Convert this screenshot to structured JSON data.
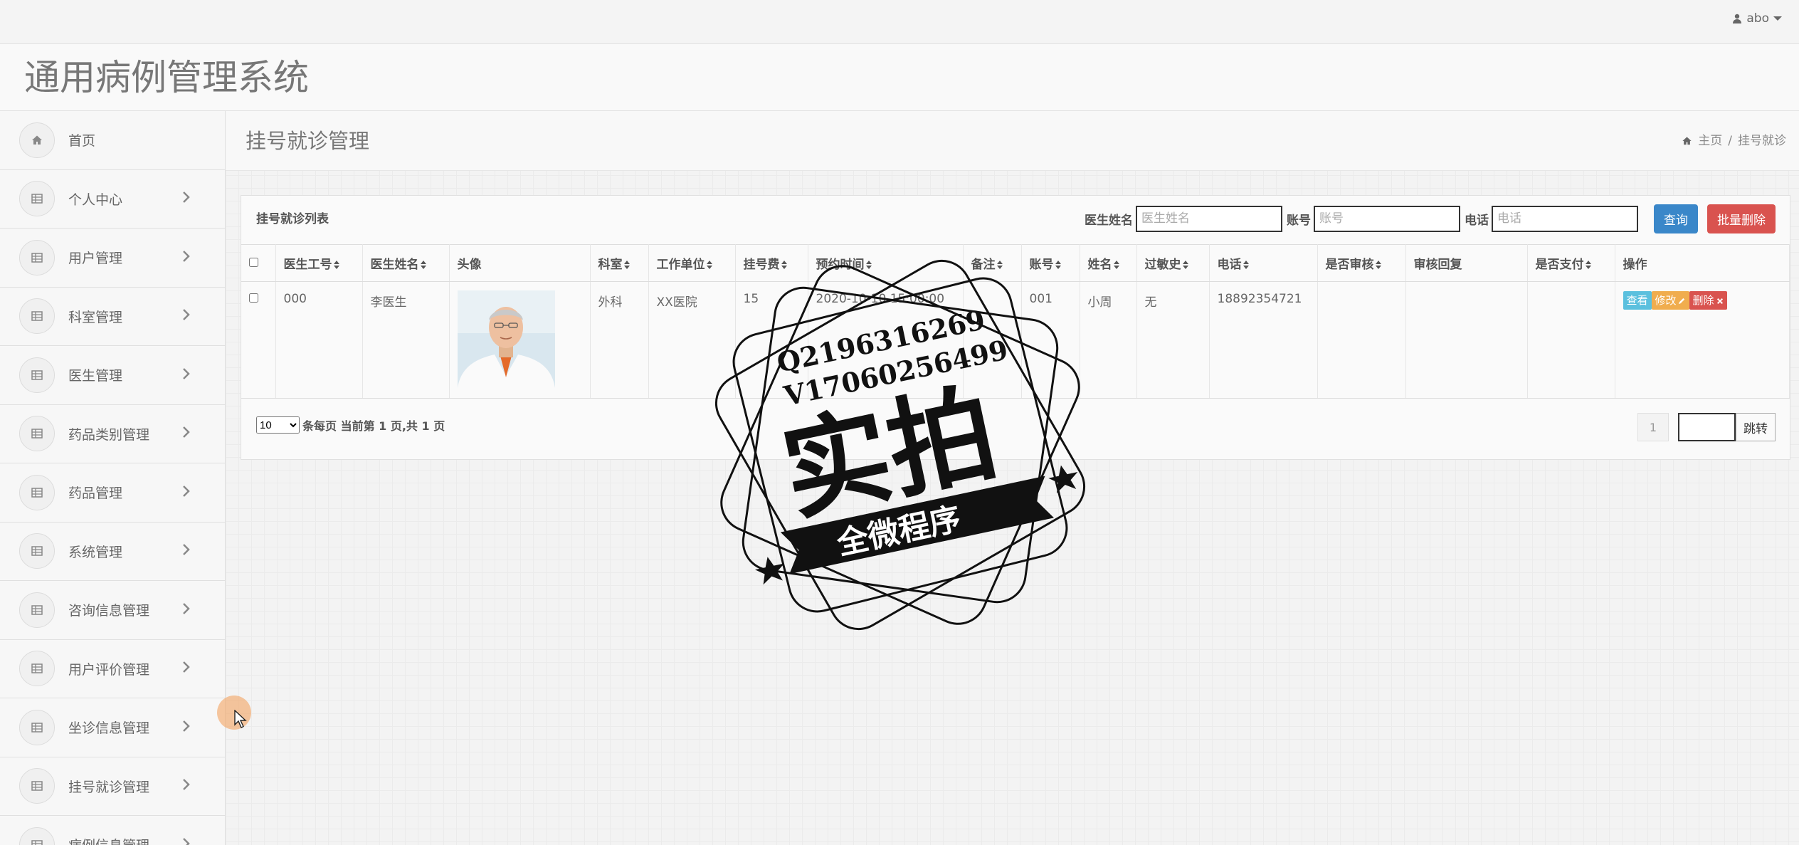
{
  "app": {
    "title": "通用病例管理系统",
    "user": "abo"
  },
  "sidebar": {
    "items": [
      {
        "label": "首页",
        "icon": "home-icon",
        "chevron": false
      },
      {
        "label": "个人中心",
        "icon": "grid-icon",
        "chevron": true
      },
      {
        "label": "用户管理",
        "icon": "grid-icon",
        "chevron": true
      },
      {
        "label": "科室管理",
        "icon": "grid-icon",
        "chevron": true
      },
      {
        "label": "医生管理",
        "icon": "grid-icon",
        "chevron": true
      },
      {
        "label": "药品类别管理",
        "icon": "grid-icon",
        "chevron": true
      },
      {
        "label": "药品管理",
        "icon": "grid-icon",
        "chevron": true
      },
      {
        "label": "系统管理",
        "icon": "grid-icon",
        "chevron": true
      },
      {
        "label": "咨询信息管理",
        "icon": "grid-icon",
        "chevron": true
      },
      {
        "label": "用户评价管理",
        "icon": "grid-icon",
        "chevron": true
      },
      {
        "label": "坐诊信息管理",
        "icon": "grid-icon",
        "chevron": true
      },
      {
        "label": "挂号就诊管理",
        "icon": "grid-icon",
        "chevron": true
      },
      {
        "label": "病例信息管理",
        "icon": "grid-icon",
        "chevron": true
      }
    ]
  },
  "page": {
    "title": "挂号就诊管理",
    "breadcrumb": {
      "home": "主页",
      "separator": "/",
      "current": "挂号就诊"
    }
  },
  "panel": {
    "title": "挂号就诊列表",
    "search": {
      "doctor_name_label": "医生姓名",
      "doctor_name_placeholder": "医生姓名",
      "account_label": "账号",
      "account_placeholder": "账号",
      "phone_label": "电话",
      "phone_placeholder": "电话",
      "query_button": "查询",
      "batch_delete_button": "批量删除"
    },
    "columns": [
      "医生工号",
      "医生姓名",
      "头像",
      "科室",
      "工作单位",
      "挂号费",
      "预约时间",
      "备注",
      "账号",
      "姓名",
      "过敏史",
      "电话",
      "是否审核",
      "审核回复",
      "是否支付",
      "操作"
    ],
    "rows": [
      {
        "doctor_id": "000",
        "doctor_name": "李医生",
        "department": "外科",
        "work_unit": "XX医院",
        "fee": "15",
        "appointment_time": "2020-10-10 15:00:00",
        "remark": "",
        "account": "001",
        "name": "小周",
        "allergy": "无",
        "phone": "18892354721",
        "reviewed": "",
        "review_reply": "",
        "paid": ""
      }
    ],
    "row_actions": {
      "view": "查看",
      "edit": "修改",
      "delete": "删除"
    },
    "pagination": {
      "page_size": "10",
      "page_size_options": [
        "10"
      ],
      "info_text": "条每页 当前第 1 页,共 1 页",
      "current_page": "1",
      "jump_button": "跳转"
    }
  },
  "watermark": {
    "line1": "Q2196316269",
    "line2": "V17060256499",
    "main": "实拍",
    "ribbon": "全微程序"
  },
  "colors": {
    "primary": "#3a87c9",
    "danger": "#d9534f",
    "info": "#5bc0de",
    "warning": "#f0ad4e"
  }
}
